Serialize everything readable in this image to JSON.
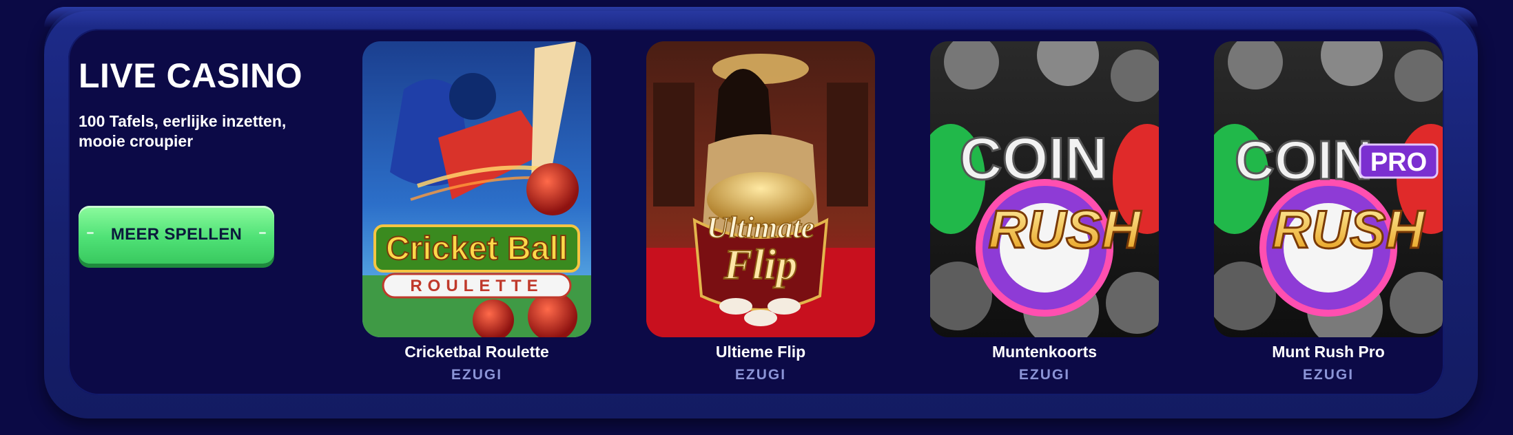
{
  "section": {
    "title": "LIVE CASINO",
    "subtitle": "100 Tafels, eerlijke inzetten, mooie croupier",
    "cta_label": "MEER SPELLEN"
  },
  "games": [
    {
      "title": "Cricketbal Roulette",
      "provider": "EZUGI",
      "art_line1": "Cricket Ball",
      "art_line2": "ROULETTE"
    },
    {
      "title": "Ultieme Flip",
      "provider": "EZUGI",
      "art_line1": "Ultimate",
      "art_line2": "Flip"
    },
    {
      "title": "Muntenkoorts",
      "provider": "EZUGI",
      "art_line1": "COIN",
      "art_line2": "RUSH"
    },
    {
      "title": "Munt Rush Pro",
      "provider": "EZUGI",
      "art_line1": "COIN",
      "art_line2": "RUSH",
      "art_badge": "PRO"
    }
  ],
  "colors": {
    "background": "#0b0a45",
    "frame": "#1d2b8a",
    "cta_green": "#4fe176",
    "provider_text": "#8b94d6"
  }
}
